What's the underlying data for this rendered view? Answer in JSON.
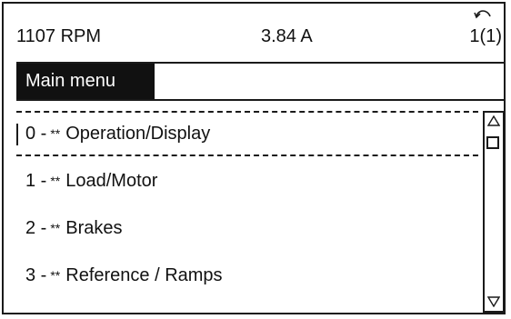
{
  "status": {
    "speed": "1107 RPM",
    "current": "3.84 A",
    "setup": "1(1)"
  },
  "menu": {
    "title": "Main menu",
    "items": [
      {
        "number": "0 -",
        "stars": "**",
        "label": "Operation/Display",
        "selected": true
      },
      {
        "number": "1 -",
        "stars": "**",
        "label": "Load/Motor",
        "selected": false
      },
      {
        "number": "2 -",
        "stars": "**",
        "label": "Brakes",
        "selected": false
      },
      {
        "number": "3 -",
        "stars": "**",
        "label": "Reference / Ramps",
        "selected": false
      }
    ]
  },
  "icons": {
    "back": "back-arrow-icon",
    "scroll_up": "triangle-up-icon",
    "scroll_down": "triangle-down-icon"
  }
}
